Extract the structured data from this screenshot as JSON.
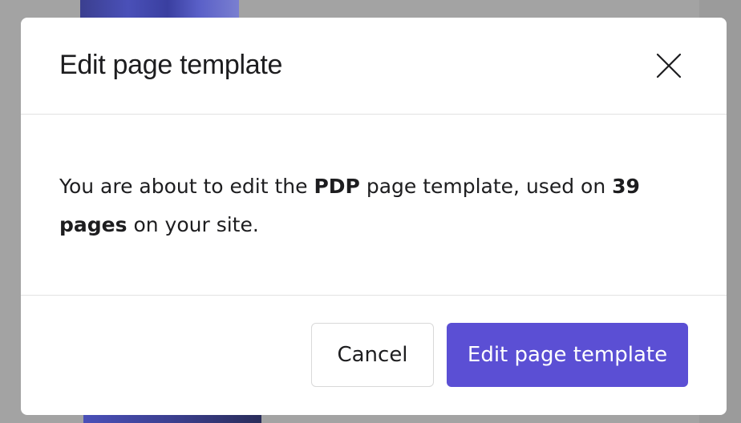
{
  "dialog": {
    "title": "Edit page template",
    "message": {
      "prefix": "You are about to edit the ",
      "template_name": "PDP",
      "middle": " page template, used on ",
      "page_count": "39 pages",
      "suffix": " on your site."
    },
    "close_icon": "close-icon",
    "cancel_label": "Cancel",
    "confirm_label": "Edit page template"
  },
  "colors": {
    "primary": "#5b4fd4",
    "backdrop": "#a3a3a3",
    "text": "#1d1d1f"
  }
}
